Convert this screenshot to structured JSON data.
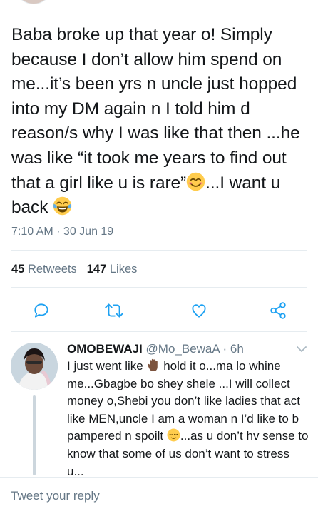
{
  "tweet": {
    "text_part1": "Baba broke up that year o! Simply because I don’t allow him spend on me...it’s been yrs n uncle just hopped into my DM again n I told him d reason/s why I was like that then ...he was like “it took me years to find out that a girl like u is rare”",
    "text_part2": "...I want u back ",
    "timestamp": "7:10 AM · 30 Jun 19",
    "emojis": [
      "smiling-face-icon",
      "tears-of-joy-icon"
    ]
  },
  "stats": {
    "retweets_count": "45",
    "retweets_label": "Retweets",
    "likes_count": "147",
    "likes_label": "Likes"
  },
  "actions": [
    "reply-icon",
    "retweet-icon",
    "heart-icon",
    "share-icon"
  ],
  "reply": {
    "display_name": "OMOBEWAJI",
    "handle_time": "@Mo_BewaA · 6h",
    "text_part1": "I just went like ",
    "text_part2": " hold it o...ma lo whine me...Gbagbe bo shey shele ...I will collect money o,Shebi you don’t like ladies that act like MEN,uncle I am a woman n I’d like to b pampered n spoilt ",
    "text_part3": "...as u don’t hv sense to know that some of us don’t want to stress u...",
    "emojis": [
      "raised-hand-icon",
      "relieved-face-icon"
    ]
  },
  "compose": {
    "placeholder": "Tweet your reply"
  },
  "colors": {
    "text": "#14171a",
    "secondary": "#657786",
    "icon": "#1da1f2",
    "divider": "#e6ecf0"
  }
}
